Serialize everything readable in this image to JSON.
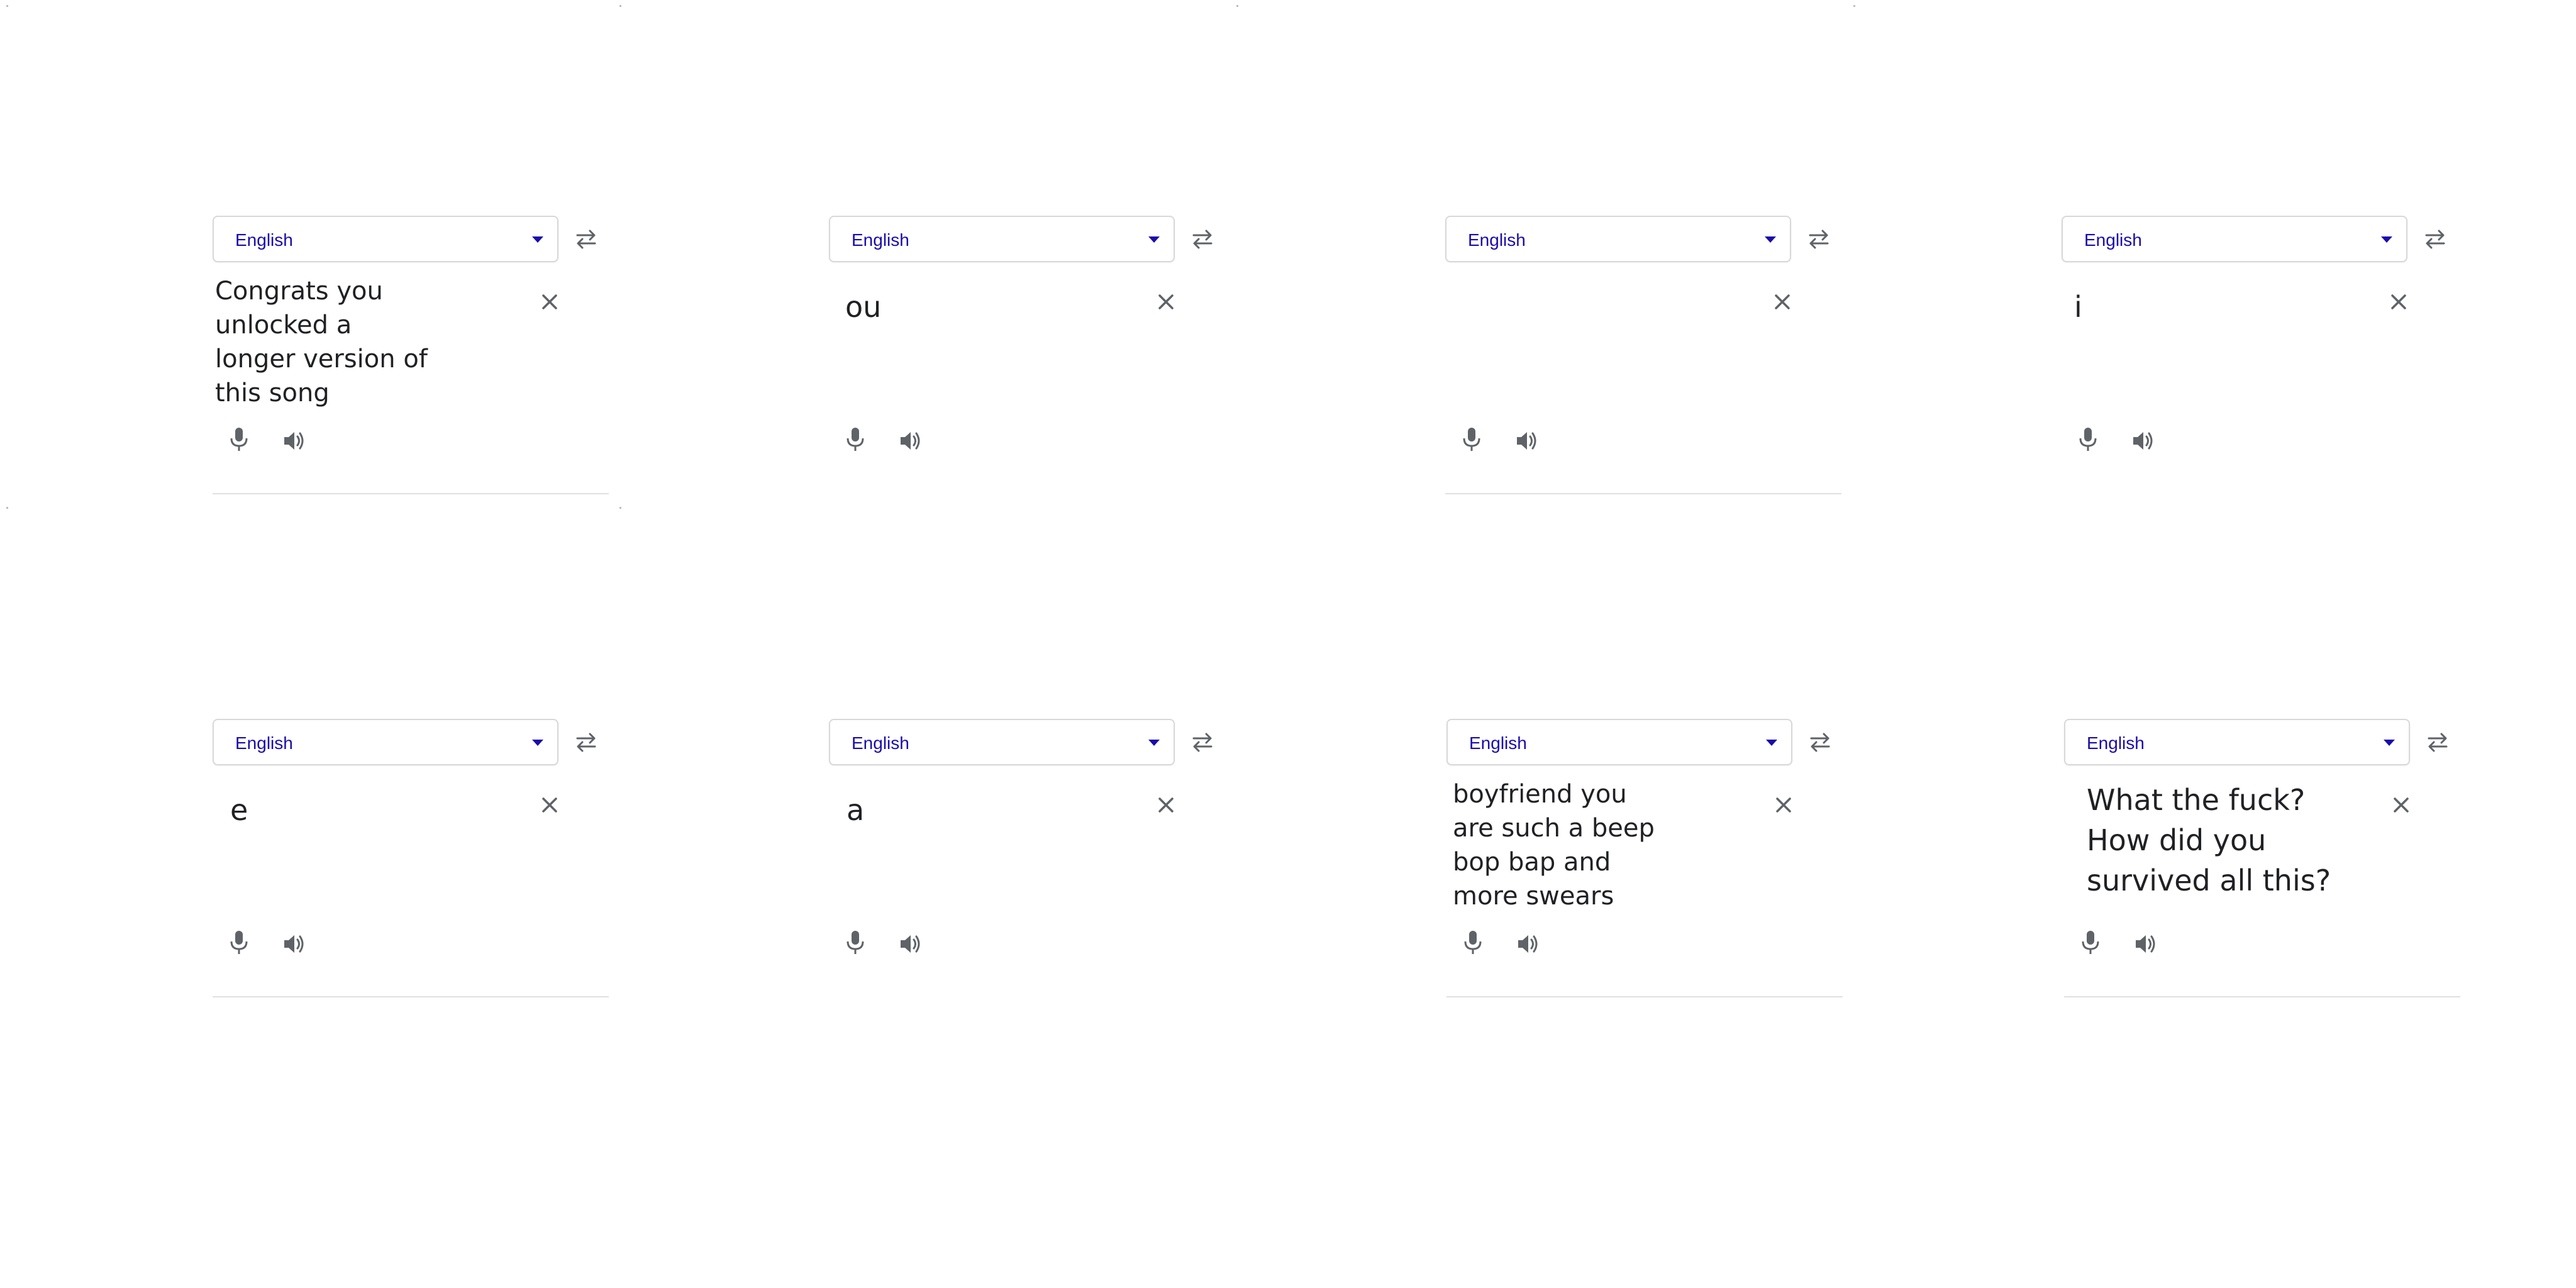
{
  "panels": [
    {
      "language": "English",
      "text": "Congrats you unlocked a longer version of this song"
    },
    {
      "language": "English",
      "text": "ou"
    },
    {
      "language": "English",
      "text": ""
    },
    {
      "language": "English",
      "text": "i"
    },
    {
      "language": "English",
      "text": "e"
    },
    {
      "language": "English",
      "text": "a"
    },
    {
      "language": "English",
      "text": "boyfriend you are such a beep bop bap and more swears"
    },
    {
      "language": "English",
      "text": "What the fuck? How did you survived all this?"
    }
  ],
  "icons": {
    "dropdown": "chevron-down-icon",
    "swap": "swap-arrows-icon",
    "clear": "close-icon",
    "mic": "microphone-icon",
    "speaker": "speaker-icon"
  },
  "colors": {
    "language_text": "#1a0dab",
    "icon_gray": "#5f6368",
    "text": "#202124",
    "border": "#d8d8d8",
    "divider": "#e0e0e0"
  }
}
